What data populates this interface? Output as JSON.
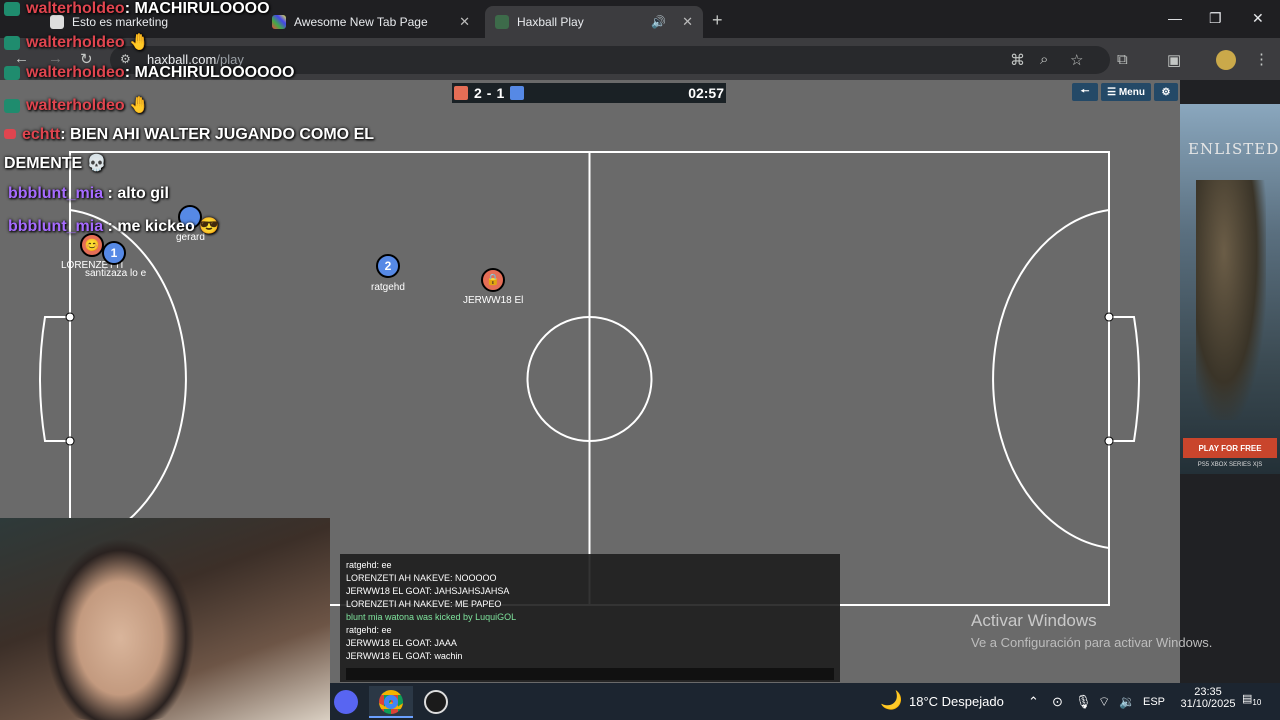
{
  "browser": {
    "tabs": [
      {
        "label": "Esto es marketing"
      },
      {
        "label": "Awesome New Tab Page"
      },
      {
        "label": "Haxball Play",
        "active": true
      }
    ],
    "address": "haxball.com",
    "address_path": "/play"
  },
  "scoreboard": {
    "red_score": "2",
    "separator": "-",
    "blue_score": "1",
    "time": "02:57"
  },
  "menu": {
    "back_icon": "🠔",
    "menu_label": "Menu",
    "settings_icon": "⚙"
  },
  "players": [
    {
      "name": "LORENZETTI",
      "team": "red",
      "avatar": "😊"
    },
    {
      "name": "santizaza lo e",
      "team": "blue",
      "avatar": "1"
    },
    {
      "name": "gerard",
      "team": "blue",
      "avatar": ""
    },
    {
      "name": "ratgehd",
      "team": "blue",
      "avatar": "2"
    },
    {
      "name": "JERWW18 El",
      "team": "red",
      "avatar": "🔒"
    }
  ],
  "overlay_chat": [
    {
      "user": "walterholdeo",
      "text": ": MACHIRULOOOO"
    },
    {
      "user": "walterholdeo",
      "text": ""
    },
    {
      "user": "walterholdeo",
      "text": ": MACHIRULOOOOOO"
    },
    {
      "user": "walterholdeo",
      "text": ""
    },
    {
      "user": "echtt",
      "text": ": BIEN AHI WALTER JUGANDO COMO EL"
    },
    {
      "user": "",
      "text": "DEMENTE"
    },
    {
      "user": "bbblunt_mia",
      "text": " : alto gil"
    },
    {
      "user": "bbblunt_mia",
      "text": " : me kickeo"
    }
  ],
  "game_chat": [
    {
      "text": "ratgehd: ee"
    },
    {
      "text": "LORENZETI AH NAKEVE: NOOOOO"
    },
    {
      "text": "JERWW18 EL GOAT: JAHSJAHSJAHSA"
    },
    {
      "text": "LORENZETI AH NAKEVE: ME PAPEO"
    },
    {
      "text": "blunt mia watona was kicked by LuquiGOL",
      "system": true
    },
    {
      "text": "ratgehd: ee"
    },
    {
      "text": "JERWW18 EL GOAT: JAAA"
    },
    {
      "text": "JERWW18 EL GOAT: wachin"
    }
  ],
  "ad": {
    "title": "ENLISTED",
    "cta": "PLAY FOR FREE",
    "platforms": "PS5  XBOX SERIES X|S"
  },
  "activate_windows": {
    "title": "Activar Windows",
    "subtitle": "Ve a Configuración para activar Windows."
  },
  "taskbar": {
    "weather": "18°C  Despejado",
    "lang": "ESP",
    "time": "23:35",
    "date": "31/10/2025",
    "notifications": "10"
  },
  "colors": {
    "red_team": "#e56e56",
    "blue_team": "#5689e5",
    "pitch": "#6a6a6a"
  }
}
